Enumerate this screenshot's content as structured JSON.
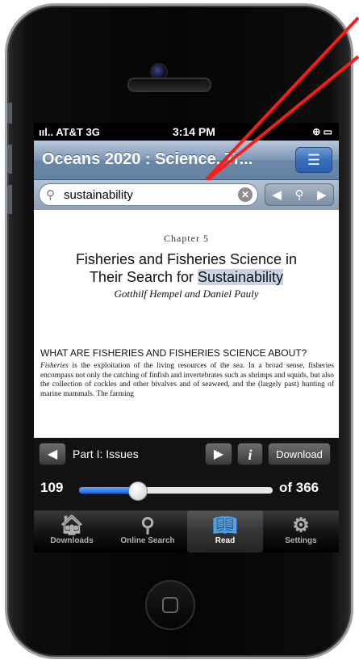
{
  "status": {
    "carrier": "AT&T 3G",
    "time": "3:14 PM"
  },
  "nav": {
    "title": "Oceans 2020 : Science, Tr...",
    "list_icon": "list-icon"
  },
  "search": {
    "query": "sustainability",
    "icons": [
      "search-icon",
      "clear-icon",
      "prev-icon",
      "search-icon",
      "next-icon"
    ]
  },
  "page": {
    "chapter": "Chapter 5",
    "title_line1": "Fisheries and Fisheries Science in",
    "title_line2_pre": "Their Search for ",
    "title_highlight": "Sustainability",
    "authors": "Gotthilf Hempel and Daniel Pauly",
    "section_heading": "WHAT ARE FISHERIES AND FISHERIES SCIENCE ABOUT?",
    "body_lead": "Fisheries",
    "body_text": " is the exploitation of the living resources of the sea. In a broad sense, fisheries encompass not only the catching of finfish and invertebrates such as shrimps and squids, but also the collection of cockles and other bivalves and of seaweed, and the (largely past) hunting of marine mammals. The farming"
  },
  "toolbar": {
    "part_label": "Part I: Issues",
    "info_label": "i",
    "download_label": "Download",
    "current_page": "109",
    "total_label": "of 366",
    "progress": 0.3
  },
  "tabs": [
    {
      "label": "Downloads",
      "icon": "home-icon"
    },
    {
      "label": "Online Search",
      "icon": "magnifier-icon"
    },
    {
      "label": "Read",
      "icon": "book-icon"
    },
    {
      "label": "Settings",
      "icon": "gear-icon"
    }
  ],
  "annotation_color": "#ff1a1a"
}
